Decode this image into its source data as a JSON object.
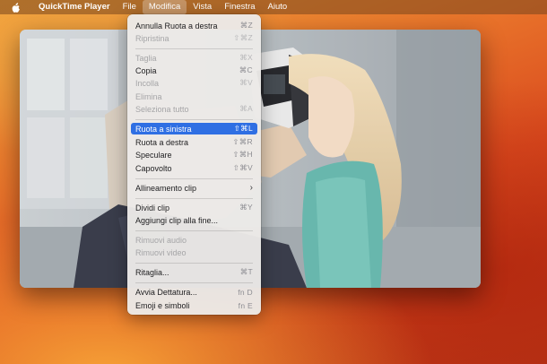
{
  "menubar": {
    "app_name": "QuickTime Player",
    "items": [
      "File",
      "Modifica",
      "Vista",
      "Finestra",
      "Aiuto"
    ]
  },
  "menu": {
    "items": [
      {
        "label": "Annulla Ruota a destra",
        "shortcut": "⌘Z",
        "enabled": true
      },
      {
        "label": "Ripristina",
        "shortcut": "⇧⌘Z",
        "enabled": false
      },
      {
        "label": "Taglia",
        "shortcut": "⌘X",
        "enabled": false
      },
      {
        "label": "Copia",
        "shortcut": "⌘C",
        "enabled": true
      },
      {
        "label": "Incolla",
        "shortcut": "⌘V",
        "enabled": false
      },
      {
        "label": "Elimina",
        "shortcut": "",
        "enabled": false
      },
      {
        "label": "Seleziona tutto",
        "shortcut": "⌘A",
        "enabled": false
      },
      {
        "label": "Ruota a sinistra",
        "shortcut": "⇧⌘L",
        "enabled": true,
        "highlighted": true
      },
      {
        "label": "Ruota a destra",
        "shortcut": "⇧⌘R",
        "enabled": true
      },
      {
        "label": "Speculare",
        "shortcut": "⇧⌘H",
        "enabled": true
      },
      {
        "label": "Capovolto",
        "shortcut": "⇧⌘V",
        "enabled": true
      },
      {
        "label": "Allineamento clip",
        "shortcut": "",
        "enabled": true,
        "submenu": true
      },
      {
        "label": "Dividi clip",
        "shortcut": "⌘Y",
        "enabled": true
      },
      {
        "label": "Aggiungi clip alla fine...",
        "shortcut": "",
        "enabled": true
      },
      {
        "label": "Rimuovi audio",
        "shortcut": "",
        "enabled": false
      },
      {
        "label": "Rimuovi video",
        "shortcut": "",
        "enabled": false
      },
      {
        "label": "Ritaglia...",
        "shortcut": "⌘T",
        "enabled": true
      },
      {
        "label": "Avvia Dettatura...",
        "shortcut": "fn D",
        "enabled": true
      },
      {
        "label": "Emoji e simboli",
        "shortcut": "fn E",
        "enabled": true
      }
    ]
  },
  "icons": {
    "apple": "apple-logo-icon",
    "submenu": "chevron-right-icon"
  },
  "colors": {
    "highlight": "#2f6fe3",
    "menu_background": "#eceae8",
    "disabled_text": "#a5a5a7"
  }
}
